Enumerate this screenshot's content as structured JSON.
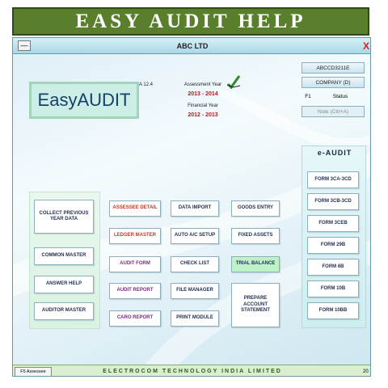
{
  "banner": {
    "title": "EASY AUDIT HELP"
  },
  "window": {
    "title": "ABC LTD",
    "minimize": "—",
    "close": "X"
  },
  "logo": {
    "text": "EasyAUDIT",
    "version": "A 12.4"
  },
  "years": {
    "assessment_label": "Assessment Year",
    "assessment_value": "2013 - 2014",
    "financial_label": "Financial Year",
    "financial_value": "2012 - 2013"
  },
  "info": {
    "code": "ABCCD3211E",
    "company": "COMPANY (D)",
    "f1": "F1",
    "status": "Status",
    "note": "Note (Ctrl+A)"
  },
  "left": {
    "collect": "COLLECT PREVIOUS YEAR DATA",
    "common_master": "COMMON MASTER",
    "answer_help": "ANSWER HELP",
    "auditor_master": "AUDITOR MASTER"
  },
  "mid": {
    "assessee_detail": "ASSESSEE DETAIL",
    "ledger_master": "LEDGER MASTER",
    "audit_form": "AUDIT FORM",
    "audit_report": "AUDIT REPORT",
    "caro_report": "CARO REPORT",
    "data_import": "DATA IMPORT",
    "auto_ac_setup": "AUTO A/C SETUP",
    "check_list": "CHECK LIST",
    "file_manager": "FILE MANAGER",
    "print_module": "PRINT MODULE",
    "goods_entry": "GOODS ENTRY",
    "fixed_assets": "FIXED ASSETS",
    "trial_balance": "TRIAL BALANCE",
    "prepare_account": "PREPARE ACCOUNT STATEMENT"
  },
  "eaudit": {
    "title": "e-AUDIT",
    "forms": [
      "FORM 3CA-3CD",
      "FORM 3CB-3CD",
      "FORM 3CEB",
      "FORM 29B",
      "FORM 6B",
      "FORM 10B",
      "FORM 10BB"
    ]
  },
  "statusbar": {
    "f5": "F5 Assessee",
    "company": "ELECTROCOM TECHNOLOGY INDIA LIMITED",
    "page": "20"
  }
}
